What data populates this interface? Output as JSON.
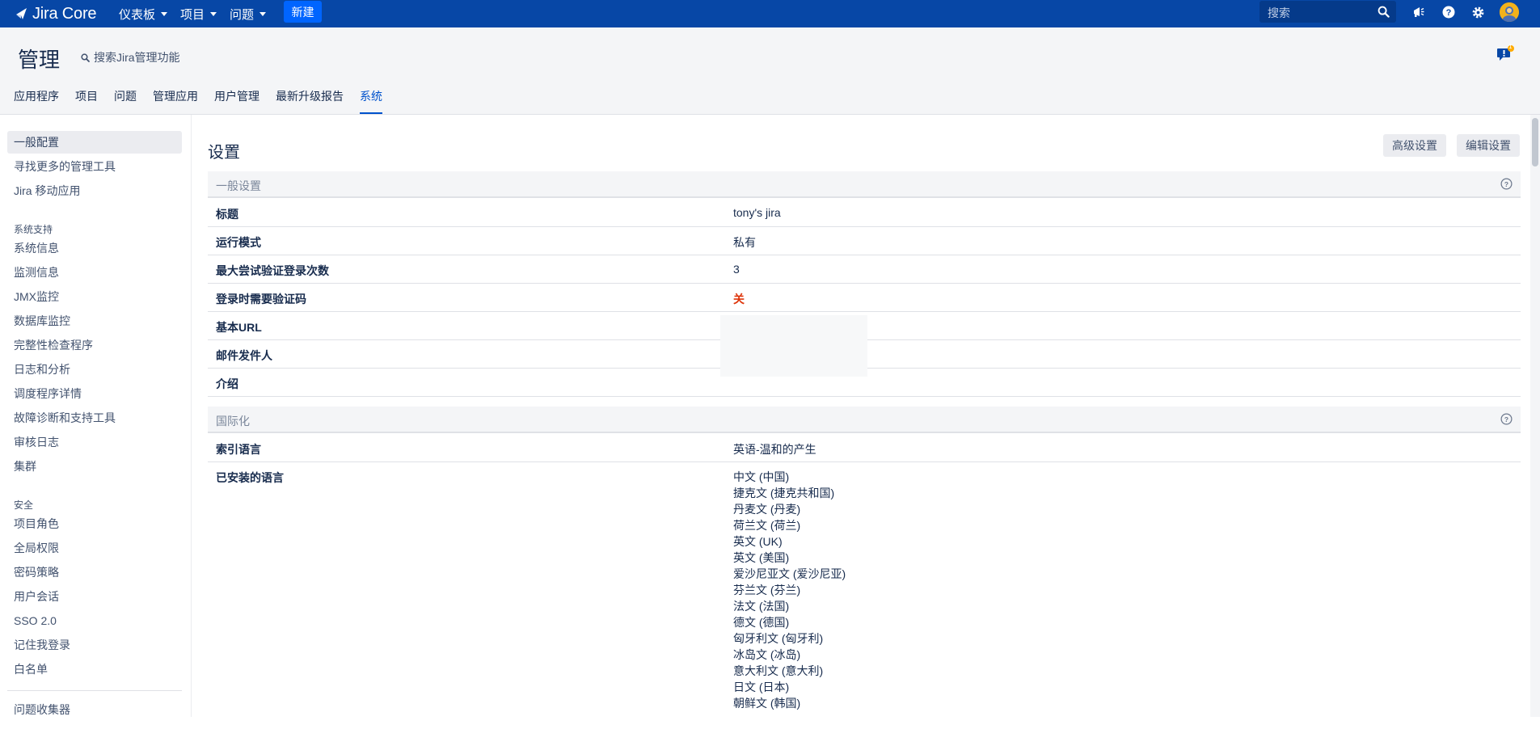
{
  "topnav": {
    "logo_text": "Jira Core",
    "menus": [
      {
        "label": "仪表板"
      },
      {
        "label": "项目"
      },
      {
        "label": "问题"
      }
    ],
    "create_label": "新建",
    "search_placeholder": "搜索",
    "icons": [
      "megaphone-icon",
      "help-icon",
      "settings-icon",
      "avatar"
    ]
  },
  "admin": {
    "title": "管理",
    "search_label": "搜索Jira管理功能",
    "feedback_badge": "1",
    "tabs": [
      {
        "label": "应用程序"
      },
      {
        "label": "项目"
      },
      {
        "label": "问题"
      },
      {
        "label": "管理应用"
      },
      {
        "label": "用户管理"
      },
      {
        "label": "最新升级报告"
      },
      {
        "label": "系统"
      }
    ],
    "active_tab": "系统"
  },
  "sidebar": {
    "top_items": [
      {
        "label": "一般配置"
      },
      {
        "label": "寻找更多的管理工具"
      },
      {
        "label": "Jira 移动应用"
      }
    ],
    "support_heading": "系统支持",
    "support_items": [
      {
        "label": "系统信息"
      },
      {
        "label": "监测信息"
      },
      {
        "label": "JMX监控"
      },
      {
        "label": "数据库监控"
      },
      {
        "label": "完整性检查程序"
      },
      {
        "label": "日志和分析"
      },
      {
        "label": "调度程序详情"
      },
      {
        "label": "故障诊断和支持工具"
      },
      {
        "label": "审核日志"
      },
      {
        "label": "集群"
      }
    ],
    "security_heading": "安全",
    "security_items": [
      {
        "label": "项目角色"
      },
      {
        "label": "全局权限"
      },
      {
        "label": "密码策略"
      },
      {
        "label": "用户会话"
      },
      {
        "label": "SSO 2.0"
      },
      {
        "label": "记住我登录"
      },
      {
        "label": "白名单"
      }
    ],
    "bottom_items": [
      {
        "label": "问题收集器"
      }
    ]
  },
  "main": {
    "title": "设置",
    "advanced_button": "高级设置",
    "edit_button": "编辑设置",
    "general": {
      "heading": "一般设置",
      "rows": [
        {
          "key": "标题",
          "value": "tony's jira"
        },
        {
          "key": "运行模式",
          "value": "私有"
        },
        {
          "key": "最大尝试验证登录次数",
          "value": "3"
        },
        {
          "key": "登录时需要验证码",
          "value": "关"
        },
        {
          "key": "基本URL",
          "value": ""
        },
        {
          "key": "邮件发件人",
          "value": ""
        },
        {
          "key": "介绍",
          "value": ""
        }
      ]
    },
    "i18n": {
      "heading": "国际化",
      "index_language_key": "索引语言",
      "index_language_value": "英语-温和的产生",
      "installed_key": "已安装的语言",
      "installed_languages": [
        "中文 (中国)",
        "捷克文 (捷克共和国)",
        "丹麦文 (丹麦)",
        "荷兰文 (荷兰)",
        "英文 (UK)",
        "英文 (美国)",
        "爱沙尼亚文 (爱沙尼亚)",
        "芬兰文 (芬兰)",
        "法文 (法国)",
        "德文 (德国)",
        "匈牙利文 (匈牙利)",
        "冰岛文 (冰岛)",
        "意大利文 (意大利)",
        "日文 (日本)",
        "朝鲜文 (韩国)"
      ]
    }
  },
  "colors": {
    "topnav": "#0747a6",
    "create_button": "#0065ff",
    "active_tab": "#0052cc",
    "captcha_off": "#de350b"
  }
}
